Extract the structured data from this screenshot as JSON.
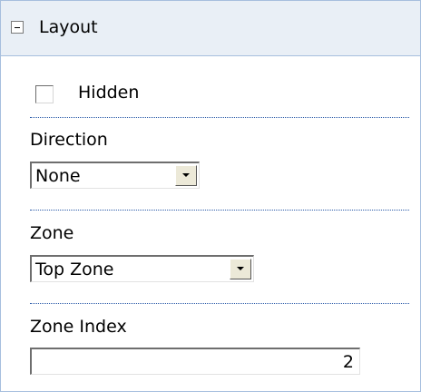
{
  "section": {
    "title": "Layout",
    "toggle_icon": "collapse-minus-icon"
  },
  "hidden": {
    "label": "Hidden",
    "checked": false
  },
  "direction": {
    "label": "Direction",
    "value": "None"
  },
  "zone": {
    "label": "Zone",
    "value": "Top Zone"
  },
  "zone_index": {
    "label": "Zone Index",
    "value": "2"
  },
  "colors": {
    "header_background": "#e9eff6",
    "border": "#a7bfde",
    "divider": "#2a5aa8"
  }
}
